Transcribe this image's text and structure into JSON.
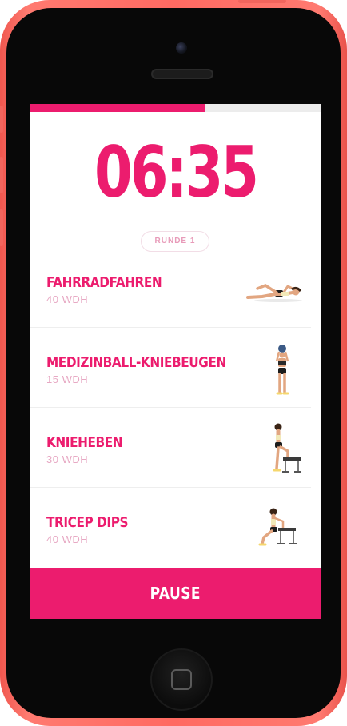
{
  "colors": {
    "accent": "#ec1c6e",
    "subtext": "#e7a8c3",
    "phone_body": "#ff6a62"
  },
  "progress": {
    "fraction": 0.6
  },
  "timer": {
    "value": "06:35"
  },
  "round": {
    "label": "RUNDE 1"
  },
  "exercises": [
    {
      "name": "FAHRRADFAHREN",
      "reps": "40 WDH",
      "icon": "bicycle-crunch-figure"
    },
    {
      "name": "MEDIZINBALL-KNIEBEUGEN",
      "reps": "15 WDH",
      "icon": "medicine-ball-squat-figure"
    },
    {
      "name": "KNIEHEBEN",
      "reps": "30 WDH",
      "icon": "knee-raise-bench-figure"
    },
    {
      "name": "TRICEP DIPS",
      "reps": "40 WDH",
      "icon": "tricep-dips-bench-figure"
    }
  ],
  "pause_button": {
    "label": "PAUSE"
  }
}
